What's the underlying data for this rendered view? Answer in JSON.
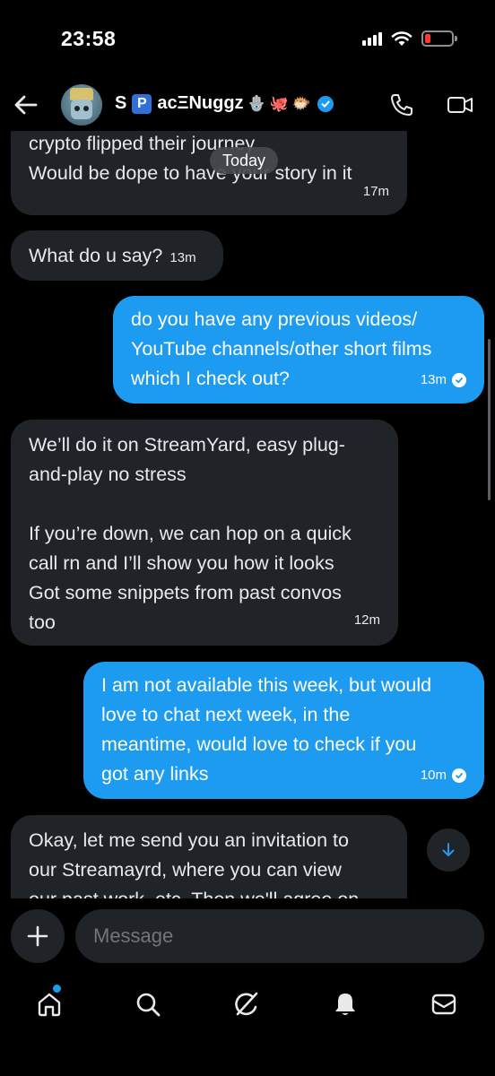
{
  "status_bar": {
    "time": "23:58",
    "colors": {
      "battery_low": "#ff3b30"
    },
    "icons": [
      "signal-icon",
      "wifi-icon",
      "battery-icon"
    ]
  },
  "header": {
    "name_prefix": "S",
    "name_badge": "P",
    "name_suffix": "acΞNuggz",
    "name_emojis": [
      "🪬",
      "🐙",
      "🐡"
    ],
    "icons": [
      "back-arrow-icon",
      "verified-badge-icon",
      "phone-icon",
      "video-icon"
    ]
  },
  "chat": {
    "date_pill": "Today",
    "messages": [
      {
        "side": "received",
        "lines": [
          "crypto flipped their journey",
          "Would be dope to have your story in it"
        ],
        "time": "17m"
      },
      {
        "side": "received",
        "lines": [
          "What do u say?"
        ],
        "time": "13m"
      },
      {
        "side": "sent",
        "lines": [
          "do you have any previous videos/",
          "YouTube channels/other short films",
          "which I check out?"
        ],
        "time": "13m"
      },
      {
        "side": "received",
        "lines": [
          "We’ll do it on StreamYard, easy plug-",
          "and-play no stress",
          "",
          "If you’re down, we can hop on a quick",
          "call rn and I’ll show you how it looks",
          "Got some snippets from past convos",
          "too"
        ],
        "time": "12m"
      },
      {
        "side": "sent",
        "lines": [
          "I am not available this week, but would",
          "love to chat next week, in the",
          "meantime, would love to check if you",
          "got any links"
        ],
        "time": "10m"
      },
      {
        "side": "received",
        "lines": [
          "Okay, let me send you an invitation to",
          "our Streamayrd, where you can view",
          "our past work, etc. Then we'll agree on"
        ],
        "time": ""
      }
    ]
  },
  "composer": {
    "placeholder": "Message"
  },
  "bottom_nav": {
    "items": [
      "home-icon",
      "search-icon",
      "grok-icon",
      "notifications-icon",
      "messages-icon"
    ]
  },
  "colors": {
    "accent": "#1d9bf0",
    "received_bubble": "#202327",
    "background": "#000000"
  }
}
